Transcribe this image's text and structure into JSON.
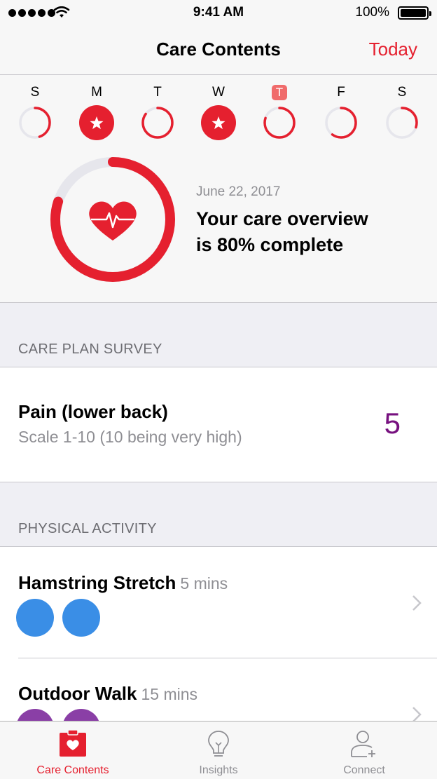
{
  "status_bar": {
    "time": "9:41 AM",
    "battery": "100%"
  },
  "nav": {
    "title": "Care Contents",
    "today_button": "Today"
  },
  "week": {
    "days": [
      {
        "letter": "S",
        "completion": 0.45,
        "starred": false,
        "selected": false
      },
      {
        "letter": "M",
        "completion": 1.0,
        "starred": true,
        "selected": false
      },
      {
        "letter": "T",
        "completion": 0.85,
        "starred": false,
        "selected": false
      },
      {
        "letter": "W",
        "completion": 1.0,
        "starred": true,
        "selected": false
      },
      {
        "letter": "T",
        "completion": 0.8,
        "starred": false,
        "selected": true
      },
      {
        "letter": "F",
        "completion": 0.6,
        "starred": false,
        "selected": false
      },
      {
        "letter": "S",
        "completion": 0.3,
        "starred": false,
        "selected": false
      }
    ]
  },
  "overview": {
    "date": "June 22, 2017",
    "line1": "Your care overview",
    "line2": "is 80% complete",
    "completion": 0.8
  },
  "survey_section": {
    "header": "CARE PLAN SURVEY",
    "item": {
      "title": "Pain (lower back)",
      "subtitle": "Scale 1-10 (10 being very high)",
      "value": "5"
    }
  },
  "activity_section": {
    "header": "PHYSICAL ACTIVITY",
    "items": [
      {
        "title": "Hamstring Stretch",
        "duration": "5 mins"
      },
      {
        "title": "Outdoor Walk",
        "duration": "15 mins"
      }
    ]
  },
  "tab_bar": {
    "tabs": [
      {
        "label": "Care Contents",
        "active": true
      },
      {
        "label": "Insights",
        "active": false
      },
      {
        "label": "Connect",
        "active": false
      }
    ]
  },
  "colors": {
    "accent": "#e5202f",
    "value_purple": "#77117f",
    "activity_blue": "#3a8ee6",
    "activity_purple": "#8a3fa6",
    "ring_track": "#e6e6ec"
  }
}
